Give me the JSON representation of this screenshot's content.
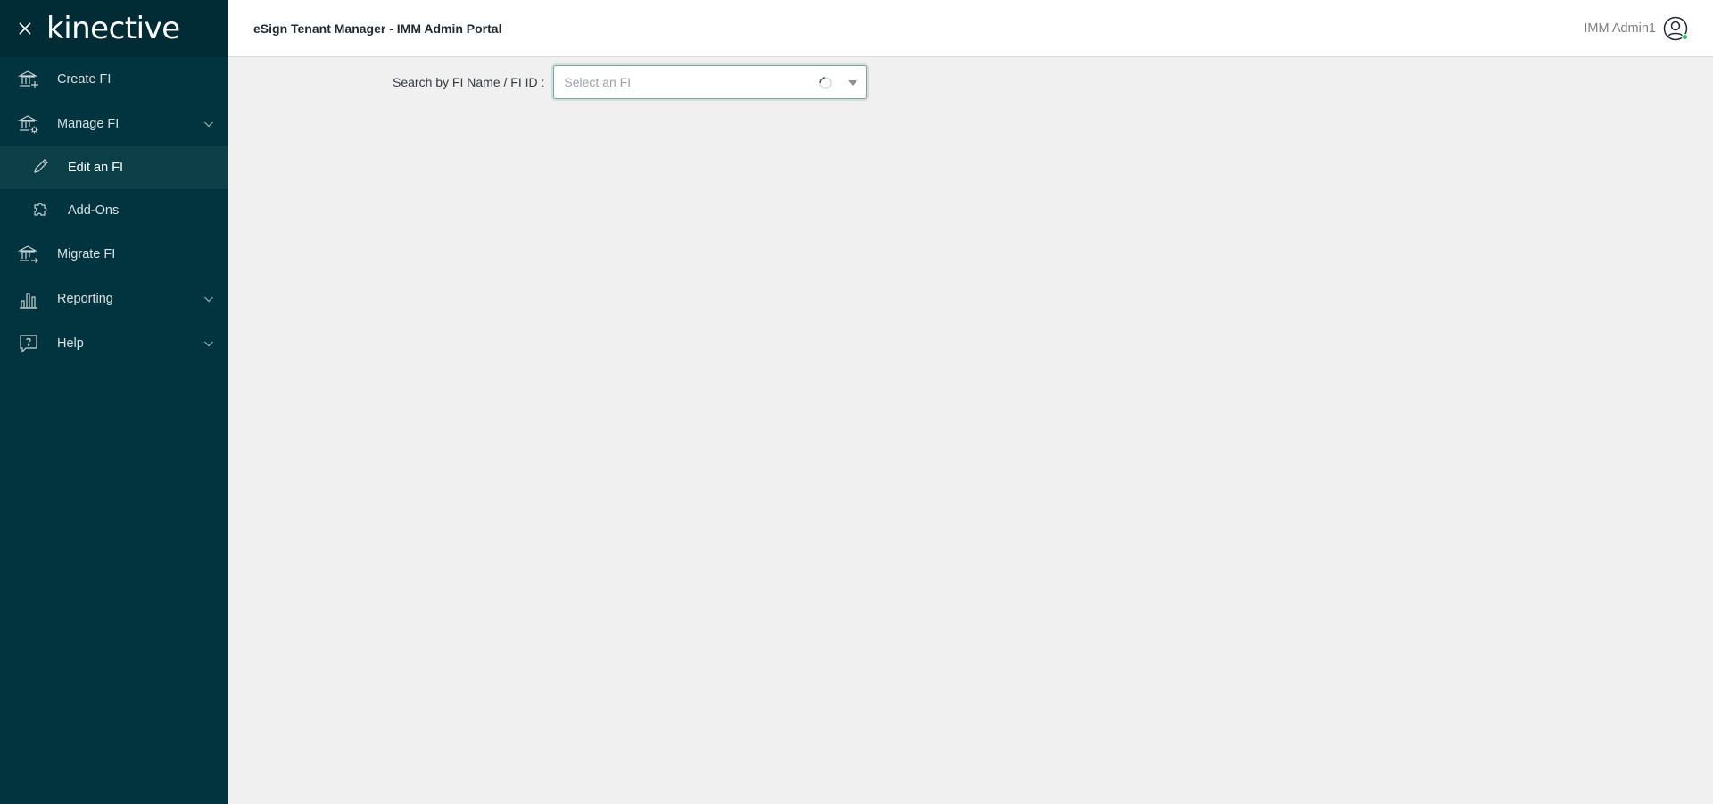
{
  "app": {
    "logo_text": "kinective",
    "title": "eSign Tenant Manager - IMM Admin Portal"
  },
  "user": {
    "name": "IMM Admin1",
    "status_color": "#2dbb5e"
  },
  "sidebar": {
    "items": [
      {
        "label": "Create FI",
        "icon": "bank-add-icon"
      },
      {
        "label": "Manage FI",
        "icon": "bank-settings-icon",
        "expandable": true,
        "expanded": true
      },
      {
        "label": "Edit an FI",
        "icon": "pencil-icon",
        "sub": true,
        "active": true
      },
      {
        "label": "Add-Ons",
        "icon": "puzzle-icon",
        "sub": true
      },
      {
        "label": "Migrate FI",
        "icon": "bank-migrate-icon"
      },
      {
        "label": "Reporting",
        "icon": "bar-chart-icon",
        "expandable": true
      },
      {
        "label": "Help",
        "icon": "help-chat-icon",
        "expandable": true
      }
    ]
  },
  "search": {
    "label": "Search by FI Name / FI ID :",
    "placeholder": "Select an FI",
    "loading": true
  },
  "colors": {
    "sidebar_bg": "#023440",
    "sidebar_header_bg": "#012c36",
    "active_item_bg": "#0d3f49",
    "content_bg": "#f0f0f0"
  }
}
